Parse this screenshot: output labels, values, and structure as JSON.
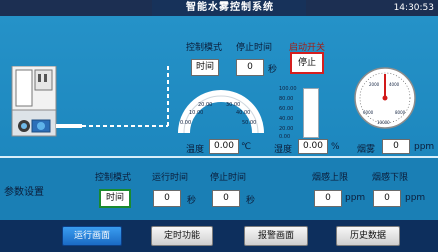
{
  "header": {
    "title": "智能水雾控制系统",
    "clock": "14:30:53"
  },
  "controls": {
    "mode_label": "控制模式",
    "mode_value": "时间",
    "stop_time_label": "停止时间",
    "stop_time_value": "0",
    "stop_time_unit": "秒",
    "start_switch_label": "启动开关",
    "start_switch_value": "停止"
  },
  "gauges": {
    "temperature": {
      "label": "温度",
      "value": "0.00",
      "unit": "℃",
      "ticks": [
        "0.00",
        "10.00",
        "20.00",
        "30.00",
        "40.00",
        "50.00"
      ],
      "level": 0
    },
    "humidity": {
      "label": "湿度",
      "value": "0.00",
      "unit": "%",
      "ticks": [
        "100.00",
        "80.00",
        "60.00",
        "40.00",
        "20.00",
        "0.00"
      ],
      "level": 0
    },
    "smoke": {
      "label": "烟雾",
      "value": "0",
      "unit": "ppm",
      "ticks": [
        "2000",
        "4000",
        "6000",
        "8000",
        "10000"
      ],
      "level": 0
    }
  },
  "params": {
    "section_title": "参数设置",
    "mode_label": "控制模式",
    "mode_value": "时间",
    "run_time_label": "运行时间",
    "run_time_value": "0",
    "run_time_unit": "秒",
    "stop_time_label": "停止时间",
    "stop_time_value": "0",
    "stop_time_unit": "秒",
    "smoke_upper_label": "烟感上限",
    "smoke_upper_value": "0",
    "smoke_upper_unit": "ppm",
    "smoke_lower_label": "烟感下限",
    "smoke_lower_value": "0",
    "smoke_lower_unit": "ppm"
  },
  "nav": {
    "run": "运行画面",
    "timer": "定时功能",
    "alarm": "报警画面",
    "history": "历史数据"
  },
  "colors": {
    "background": "#1f8fc4",
    "nav_active": "#1a6ac4",
    "header": "#1c2f52"
  }
}
